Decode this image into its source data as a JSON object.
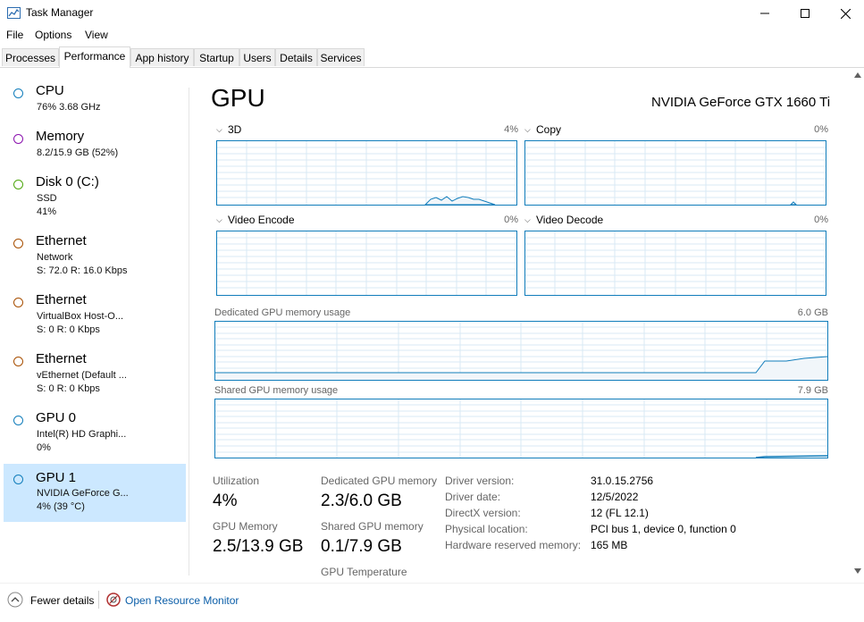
{
  "window": {
    "title": "Task Manager",
    "min_icon": "minimize-icon",
    "max_icon": "maximize-icon",
    "close_icon": "close-icon"
  },
  "menu": [
    "File",
    "Options",
    "View"
  ],
  "tabs": [
    "Processes",
    "Performance",
    "App history",
    "Startup",
    "Users",
    "Details",
    "Services"
  ],
  "active_tab": "Performance",
  "sidebar": [
    {
      "title": "CPU",
      "lines": [
        "76%  3.68 GHz"
      ],
      "color": "#117dbb"
    },
    {
      "title": "Memory",
      "lines": [
        "8.2/15.9 GB (52%)"
      ],
      "color": "#8b12ae"
    },
    {
      "title": "Disk 0 (C:)",
      "lines": [
        "SSD",
        "41%"
      ],
      "color": "#4da60c"
    },
    {
      "title": "Ethernet",
      "lines": [
        "Network",
        "S: 72.0  R: 16.0 Kbps"
      ],
      "color": "#a74f01"
    },
    {
      "title": "Ethernet",
      "lines": [
        "VirtualBox Host-O...",
        "S: 0  R: 0 Kbps"
      ],
      "color": "#a74f01"
    },
    {
      "title": "Ethernet",
      "lines": [
        "vEthernet (Default ...",
        "S: 0  R: 0 Kbps"
      ],
      "color": "#a74f01"
    },
    {
      "title": "GPU 0",
      "lines": [
        "Intel(R) HD Graphi...",
        "0%"
      ],
      "color": "#117dbb"
    },
    {
      "title": "GPU 1",
      "lines": [
        "NVIDIA GeForce G...",
        "4%  (39 °C)"
      ],
      "color": "#117dbb",
      "selected": true
    }
  ],
  "main": {
    "title": "GPU",
    "model": "NVIDIA GeForce GTX 1660 Ti",
    "engines": [
      {
        "label": "3D",
        "pct": "4%"
      },
      {
        "label": "Copy",
        "pct": "0%"
      },
      {
        "label": "Video Encode",
        "pct": "0%"
      },
      {
        "label": "Video Decode",
        "pct": "0%"
      }
    ],
    "dedicated": {
      "label": "Dedicated GPU memory usage",
      "max": "6.0 GB"
    },
    "shared": {
      "label": "Shared GPU memory usage",
      "max": "7.9 GB"
    },
    "stats": {
      "utilization_label": "Utilization",
      "utilization_value": "4%",
      "dedicated_label": "Dedicated GPU memory",
      "dedicated_value": "2.3/6.0 GB",
      "gpu_memory_label": "GPU Memory",
      "gpu_memory_value": "2.5/13.9 GB",
      "shared_label": "Shared GPU memory",
      "shared_value": "0.1/7.9 GB",
      "temp_label": "GPU Temperature"
    },
    "info": [
      {
        "label": "Driver version:",
        "value": "31.0.15.2756"
      },
      {
        "label": "Driver date:",
        "value": "12/5/2022"
      },
      {
        "label": "DirectX version:",
        "value": "12 (FL 12.1)"
      },
      {
        "label": "Physical location:",
        "value": "PCI bus 1, device 0, function 0"
      },
      {
        "label": "Hardware reserved memory:",
        "value": "165 MB"
      }
    ]
  },
  "footer": {
    "fewer_details": "Fewer details",
    "open_monitor": "Open Resource Monitor"
  },
  "colors": {
    "graph_border": "#117dbb",
    "graph_grid": "#d9eaf4",
    "graph_fill": "#f1f6fa",
    "selected_bg": "#cce8ff",
    "link": "#0b5ea8"
  }
}
